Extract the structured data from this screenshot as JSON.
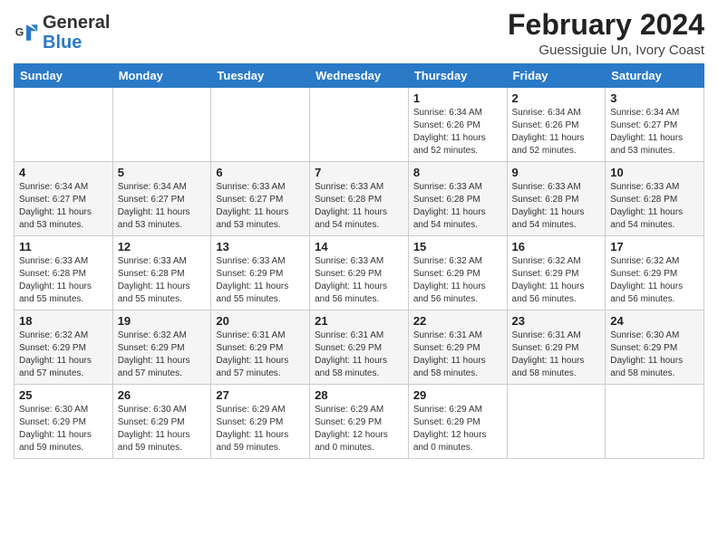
{
  "header": {
    "logo_general": "General",
    "logo_blue": "Blue",
    "month_year": "February 2024",
    "location": "Guessiguie Un, Ivory Coast"
  },
  "days": [
    "Sunday",
    "Monday",
    "Tuesday",
    "Wednesday",
    "Thursday",
    "Friday",
    "Saturday"
  ],
  "weeks": [
    [
      {
        "date": "",
        "info": ""
      },
      {
        "date": "",
        "info": ""
      },
      {
        "date": "",
        "info": ""
      },
      {
        "date": "",
        "info": ""
      },
      {
        "date": "1",
        "info": "Sunrise: 6:34 AM\nSunset: 6:26 PM\nDaylight: 11 hours\nand 52 minutes."
      },
      {
        "date": "2",
        "info": "Sunrise: 6:34 AM\nSunset: 6:26 PM\nDaylight: 11 hours\nand 52 minutes."
      },
      {
        "date": "3",
        "info": "Sunrise: 6:34 AM\nSunset: 6:27 PM\nDaylight: 11 hours\nand 53 minutes."
      }
    ],
    [
      {
        "date": "4",
        "info": "Sunrise: 6:34 AM\nSunset: 6:27 PM\nDaylight: 11 hours\nand 53 minutes."
      },
      {
        "date": "5",
        "info": "Sunrise: 6:34 AM\nSunset: 6:27 PM\nDaylight: 11 hours\nand 53 minutes."
      },
      {
        "date": "6",
        "info": "Sunrise: 6:33 AM\nSunset: 6:27 PM\nDaylight: 11 hours\nand 53 minutes."
      },
      {
        "date": "7",
        "info": "Sunrise: 6:33 AM\nSunset: 6:28 PM\nDaylight: 11 hours\nand 54 minutes."
      },
      {
        "date": "8",
        "info": "Sunrise: 6:33 AM\nSunset: 6:28 PM\nDaylight: 11 hours\nand 54 minutes."
      },
      {
        "date": "9",
        "info": "Sunrise: 6:33 AM\nSunset: 6:28 PM\nDaylight: 11 hours\nand 54 minutes."
      },
      {
        "date": "10",
        "info": "Sunrise: 6:33 AM\nSunset: 6:28 PM\nDaylight: 11 hours\nand 54 minutes."
      }
    ],
    [
      {
        "date": "11",
        "info": "Sunrise: 6:33 AM\nSunset: 6:28 PM\nDaylight: 11 hours\nand 55 minutes."
      },
      {
        "date": "12",
        "info": "Sunrise: 6:33 AM\nSunset: 6:28 PM\nDaylight: 11 hours\nand 55 minutes."
      },
      {
        "date": "13",
        "info": "Sunrise: 6:33 AM\nSunset: 6:29 PM\nDaylight: 11 hours\nand 55 minutes."
      },
      {
        "date": "14",
        "info": "Sunrise: 6:33 AM\nSunset: 6:29 PM\nDaylight: 11 hours\nand 56 minutes."
      },
      {
        "date": "15",
        "info": "Sunrise: 6:32 AM\nSunset: 6:29 PM\nDaylight: 11 hours\nand 56 minutes."
      },
      {
        "date": "16",
        "info": "Sunrise: 6:32 AM\nSunset: 6:29 PM\nDaylight: 11 hours\nand 56 minutes."
      },
      {
        "date": "17",
        "info": "Sunrise: 6:32 AM\nSunset: 6:29 PM\nDaylight: 11 hours\nand 56 minutes."
      }
    ],
    [
      {
        "date": "18",
        "info": "Sunrise: 6:32 AM\nSunset: 6:29 PM\nDaylight: 11 hours\nand 57 minutes."
      },
      {
        "date": "19",
        "info": "Sunrise: 6:32 AM\nSunset: 6:29 PM\nDaylight: 11 hours\nand 57 minutes."
      },
      {
        "date": "20",
        "info": "Sunrise: 6:31 AM\nSunset: 6:29 PM\nDaylight: 11 hours\nand 57 minutes."
      },
      {
        "date": "21",
        "info": "Sunrise: 6:31 AM\nSunset: 6:29 PM\nDaylight: 11 hours\nand 58 minutes."
      },
      {
        "date": "22",
        "info": "Sunrise: 6:31 AM\nSunset: 6:29 PM\nDaylight: 11 hours\nand 58 minutes."
      },
      {
        "date": "23",
        "info": "Sunrise: 6:31 AM\nSunset: 6:29 PM\nDaylight: 11 hours\nand 58 minutes."
      },
      {
        "date": "24",
        "info": "Sunrise: 6:30 AM\nSunset: 6:29 PM\nDaylight: 11 hours\nand 58 minutes."
      }
    ],
    [
      {
        "date": "25",
        "info": "Sunrise: 6:30 AM\nSunset: 6:29 PM\nDaylight: 11 hours\nand 59 minutes."
      },
      {
        "date": "26",
        "info": "Sunrise: 6:30 AM\nSunset: 6:29 PM\nDaylight: 11 hours\nand 59 minutes."
      },
      {
        "date": "27",
        "info": "Sunrise: 6:29 AM\nSunset: 6:29 PM\nDaylight: 11 hours\nand 59 minutes."
      },
      {
        "date": "28",
        "info": "Sunrise: 6:29 AM\nSunset: 6:29 PM\nDaylight: 12 hours\nand 0 minutes."
      },
      {
        "date": "29",
        "info": "Sunrise: 6:29 AM\nSunset: 6:29 PM\nDaylight: 12 hours\nand 0 minutes."
      },
      {
        "date": "",
        "info": ""
      },
      {
        "date": "",
        "info": ""
      }
    ]
  ]
}
